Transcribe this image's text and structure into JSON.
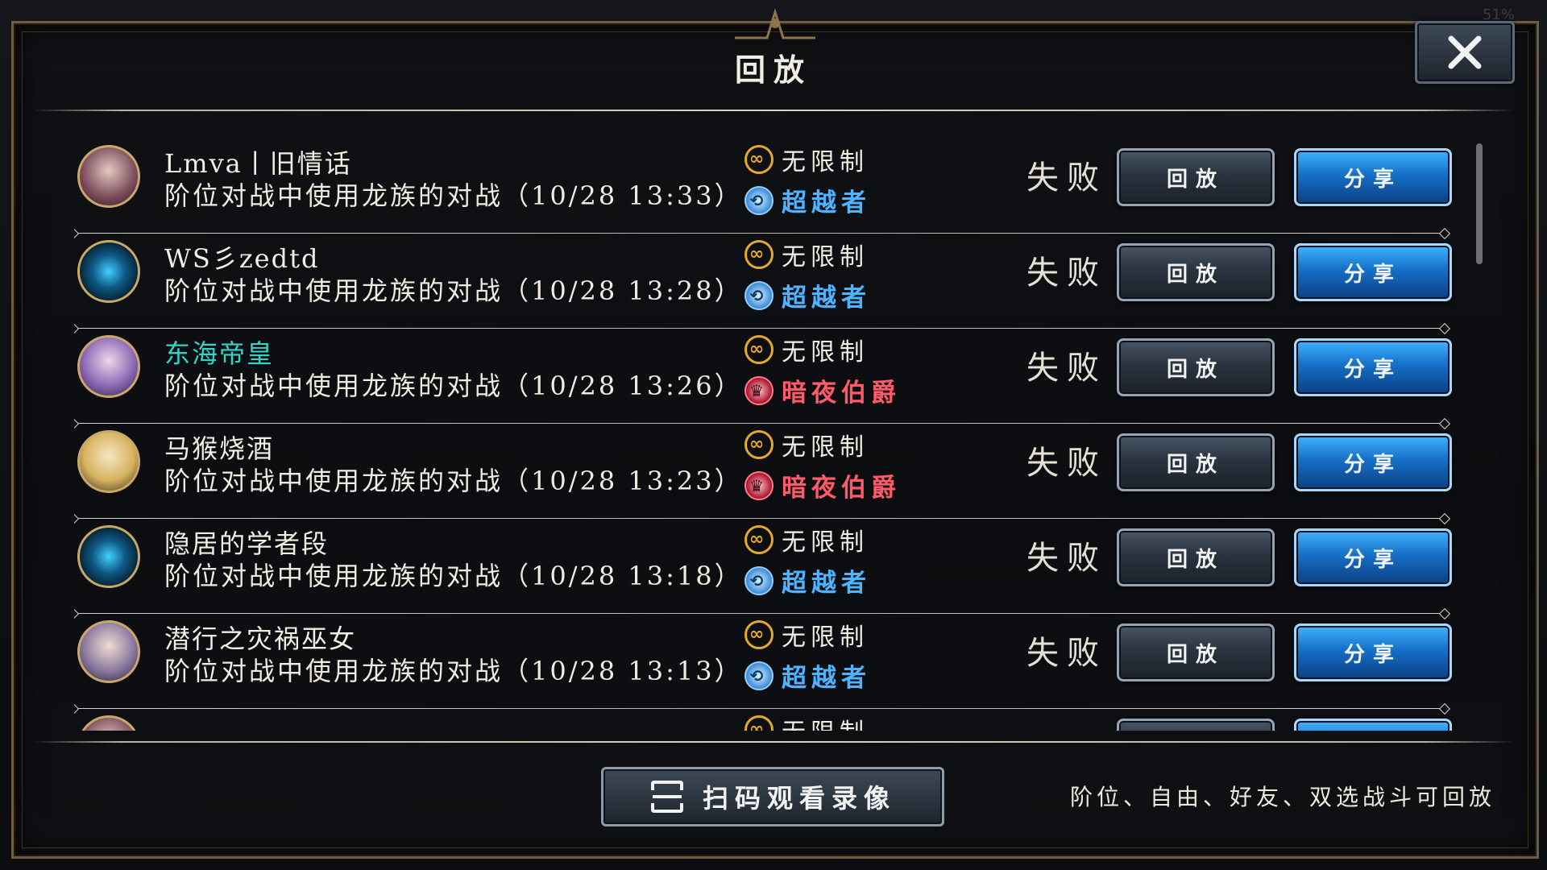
{
  "status": {
    "battery": "51%"
  },
  "dialog": {
    "title": "回放",
    "close_icon": "close-icon"
  },
  "replays": [
    {
      "name": "Lmva丨旧情话",
      "avatar": "red",
      "desc": "阶位对战中使用龙族的对战（10/28 13:33）",
      "format": "无限制",
      "class_name": "超越者",
      "class_type": "over",
      "result": "失败",
      "replay_label": "回放",
      "share_label": "分享"
    },
    {
      "name": "WS彡zedtd",
      "avatar": "blue",
      "desc": "阶位对战中使用龙族的对战（10/28 13:28）",
      "format": "无限制",
      "class_name": "超越者",
      "class_type": "over",
      "result": "失败",
      "replay_label": "回放",
      "share_label": "分享"
    },
    {
      "name": "东海帝皇",
      "avatar": "purple",
      "highlight": true,
      "desc": "阶位对战中使用龙族的对战（10/28 13:26）",
      "format": "无限制",
      "class_name": "暗夜伯爵",
      "class_type": "dark",
      "result": "失败",
      "replay_label": "回放",
      "share_label": "分享"
    },
    {
      "name": "马猴烧酒",
      "avatar": "blond",
      "desc": "阶位对战中使用龙族的对战（10/28 13:23）",
      "format": "无限制",
      "class_name": "暗夜伯爵",
      "class_type": "dark",
      "result": "失败",
      "replay_label": "回放",
      "share_label": "分享"
    },
    {
      "name": "隐居的学者段",
      "avatar": "blue",
      "desc": "阶位对战中使用龙族的对战（10/28 13:18）",
      "format": "无限制",
      "class_name": "超越者",
      "class_type": "over",
      "result": "失败",
      "replay_label": "回放",
      "share_label": "分享"
    },
    {
      "name": "潜行之灾祸巫女",
      "avatar": "hood",
      "desc": "阶位对战中使用龙族的对战（10/28 13:13）",
      "format": "无限制",
      "class_name": "超越者",
      "class_type": "over",
      "result": "失败",
      "replay_label": "回放",
      "share_label": "分享"
    },
    {
      "name": "",
      "avatar": "red",
      "desc": "",
      "format": "无限制",
      "class_name": "",
      "class_type": "over",
      "result": "",
      "replay_label": "",
      "share_label": ""
    }
  ],
  "footer": {
    "scan_label": "扫码观看录像",
    "scan_icon": "scan-icon",
    "note": "阶位、自由、好友、双选战斗可回放"
  },
  "colors": {
    "share": "#1570c8",
    "replay": "#2a333f",
    "highlight_name": "#2fd5c8",
    "over": "#4fb4ff",
    "dark": "#ff5a6a",
    "frame": "#6e5c3a"
  }
}
